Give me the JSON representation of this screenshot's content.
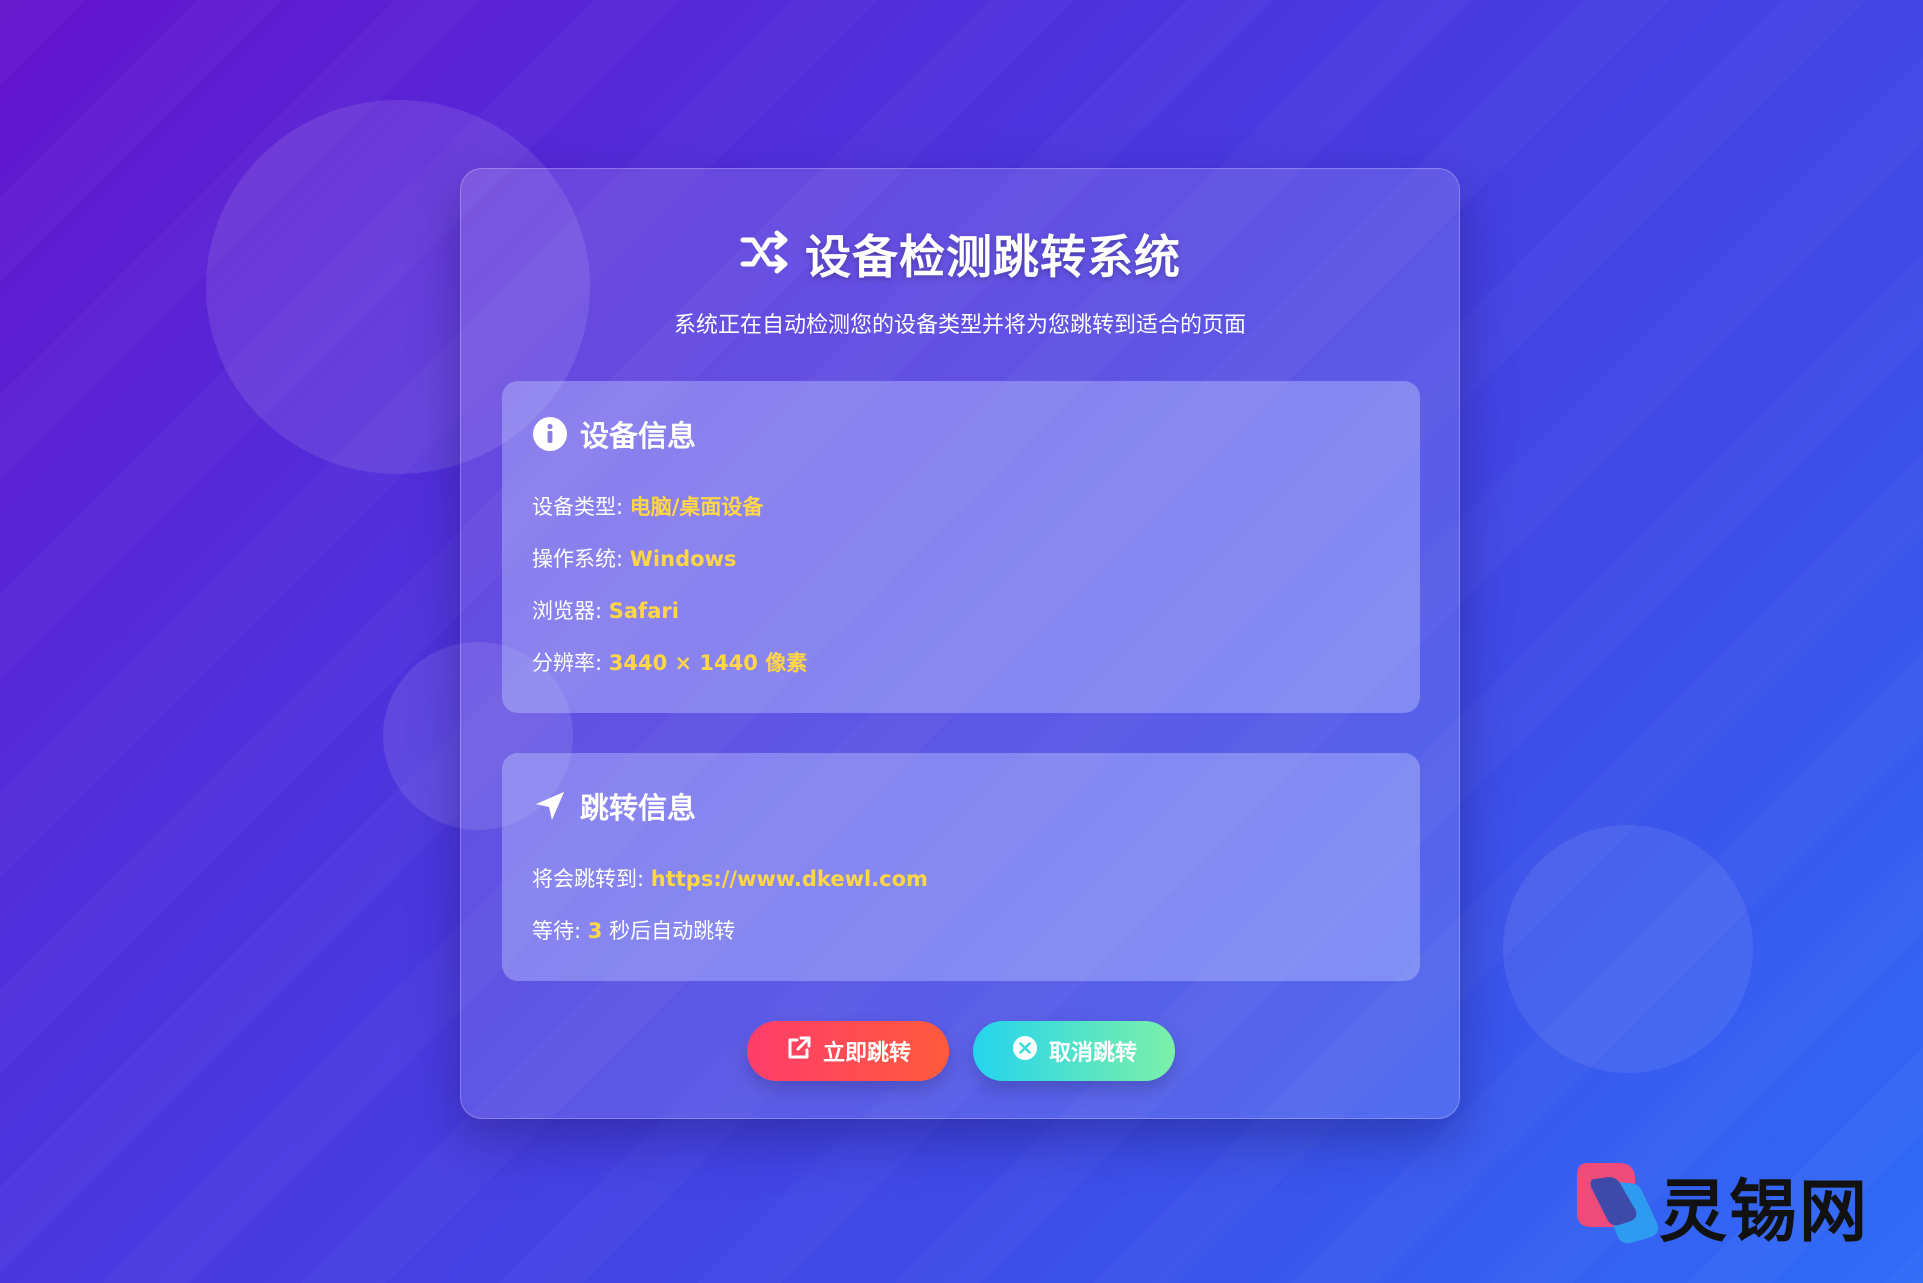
{
  "header": {
    "title": "设备检测跳转系统",
    "subtitle": "系统正在自动检测您的设备类型并将为您跳转到适合的页面"
  },
  "device_panel": {
    "heading": "设备信息",
    "rows": [
      {
        "label": "设备类型: ",
        "value": "电脑/桌面设备"
      },
      {
        "label": "操作系统: ",
        "value": "Windows"
      },
      {
        "label": "浏览器: ",
        "value": "Safari"
      },
      {
        "label": "分辨率: ",
        "value": "3440 × 1440 像素"
      }
    ]
  },
  "redirect_panel": {
    "heading": "跳转信息",
    "target_label": "将会跳转到: ",
    "target_url": "https://www.dkewl.com",
    "wait_label": "等待: ",
    "wait_seconds": "3",
    "wait_suffix": " 秒后自动跳转"
  },
  "buttons": {
    "go_label": "立即跳转",
    "cancel_label": "取消跳转"
  },
  "watermark": {
    "text": "灵锡网"
  },
  "colors": {
    "accent_value": "#ffd646",
    "go_start": "#ff3d6b",
    "go_end": "#ff5a3c",
    "cancel_start": "#24d4ee",
    "cancel_end": "#7cf0a8"
  },
  "icons": {
    "title": "shuffle-icon",
    "device_panel": "info-circle-icon",
    "redirect_panel": "paper-plane-icon",
    "go_button": "external-link-icon",
    "cancel_button": "times-circle-icon"
  }
}
